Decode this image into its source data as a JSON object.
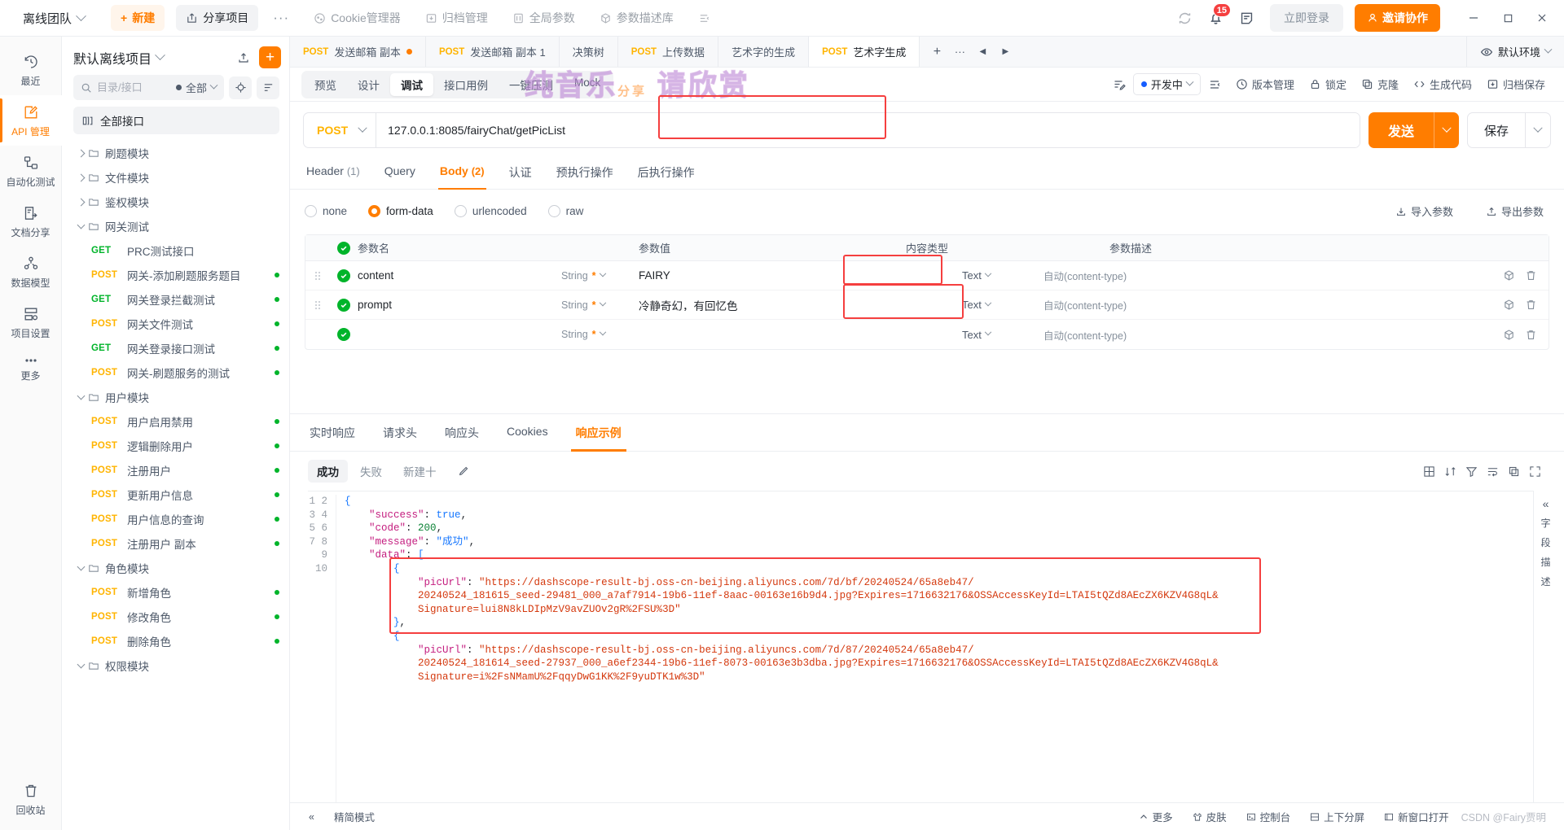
{
  "titlebar": {
    "team": "离线团队",
    "new_label": "新建",
    "share_label": "分享项目",
    "more_dots": "···",
    "menu": [
      {
        "label": "Cookie管理器",
        "icon": "cookie-icon"
      },
      {
        "label": "归档管理",
        "icon": "archive-icon"
      },
      {
        "label": "全局参数",
        "icon": "global-params-icon"
      },
      {
        "label": "参数描述库",
        "icon": "param-lib-icon"
      }
    ],
    "collapse_icon": "list-collapse-icon",
    "sync_icon": "sync-icon",
    "bell_icon": "bell-icon",
    "notif_count": "15",
    "note_icon": "note-icon",
    "login_label": "立即登录",
    "invite_label": "邀请协作",
    "minimize": "—",
    "maximize": "□",
    "close": "✕"
  },
  "rail": {
    "items": [
      {
        "label": "最近",
        "icon": "history-icon",
        "active": false
      },
      {
        "label": "API 管理",
        "icon": "api-edit-icon",
        "active": true
      },
      {
        "label": "自动化测试",
        "icon": "automation-icon",
        "active": false
      },
      {
        "label": "文档分享",
        "icon": "doc-share-icon",
        "active": false
      },
      {
        "label": "数据模型",
        "icon": "data-model-icon",
        "active": false
      },
      {
        "label": "项目设置",
        "icon": "project-settings-icon",
        "active": false
      },
      {
        "label": "更多",
        "icon": "more-dots-icon",
        "active": false
      }
    ],
    "bottom": {
      "label": "回收站",
      "icon": "trash-icon"
    }
  },
  "sidebar": {
    "project_name": "默认离线项目",
    "upload_icon": "upload-icon",
    "add_label": "+",
    "search_placeholder": "目录/接口",
    "filter_label": "全部",
    "target_icon": "target-icon",
    "sort_icon": "sort-icon",
    "all_apis": "全部接口",
    "all_apis_icon": "all-api-icon",
    "tree": [
      {
        "type": "folder",
        "label": "刷题模块",
        "expanded": false
      },
      {
        "type": "folder",
        "label": "文件模块",
        "expanded": false
      },
      {
        "type": "folder",
        "label": "鉴权模块",
        "expanded": false
      },
      {
        "type": "folder",
        "label": "网关测试",
        "expanded": true
      },
      {
        "type": "api",
        "method": "GET",
        "label": "PRC测试接口",
        "dot": false
      },
      {
        "type": "api",
        "method": "POST",
        "label": "网关-添加刷题服务题目",
        "dot": true
      },
      {
        "type": "api",
        "method": "GET",
        "label": "网关登录拦截测试",
        "dot": true
      },
      {
        "type": "api",
        "method": "POST",
        "label": "网关文件测试",
        "dot": true
      },
      {
        "type": "api",
        "method": "GET",
        "label": "网关登录接口测试",
        "dot": true
      },
      {
        "type": "api",
        "method": "POST",
        "label": "网关-刷题服务的测试",
        "dot": true
      },
      {
        "type": "folder",
        "label": "用户模块",
        "expanded": true
      },
      {
        "type": "api",
        "method": "POST",
        "label": "用户启用禁用",
        "dot": true
      },
      {
        "type": "api",
        "method": "POST",
        "label": "逻辑删除用户",
        "dot": true
      },
      {
        "type": "api",
        "method": "POST",
        "label": "注册用户",
        "dot": true
      },
      {
        "type": "api",
        "method": "POST",
        "label": "更新用户信息",
        "dot": true
      },
      {
        "type": "api",
        "method": "POST",
        "label": "用户信息的查询",
        "dot": true
      },
      {
        "type": "api",
        "method": "POST",
        "label": "注册用户 副本",
        "dot": true
      },
      {
        "type": "folder",
        "label": "角色模块",
        "expanded": true
      },
      {
        "type": "api",
        "method": "POST",
        "label": "新增角色",
        "dot": true
      },
      {
        "type": "api",
        "method": "POST",
        "label": "修改角色",
        "dot": true
      },
      {
        "type": "api",
        "method": "POST",
        "label": "删除角色",
        "dot": true
      },
      {
        "type": "folder",
        "label": "权限模块",
        "expanded": true
      }
    ],
    "footer": {
      "label": "回收站",
      "icon": "trash-icon"
    }
  },
  "doctabs": {
    "tabs": [
      {
        "method": "POST",
        "label": "发送邮箱 副本",
        "dot": true,
        "active": false
      },
      {
        "method": "POST",
        "label": "发送邮箱 副本 1",
        "dot": false,
        "active": false
      },
      {
        "method": "",
        "label": "决策树",
        "dot": false,
        "active": false
      },
      {
        "method": "POST",
        "label": "上传数据",
        "dot": false,
        "active": false
      },
      {
        "method": "",
        "label": "艺术字的生成",
        "dot": false,
        "active": false
      },
      {
        "method": "POST",
        "label": "艺术字生成",
        "dot": false,
        "active": true
      }
    ],
    "add": "+",
    "more": "···",
    "prev": "◀",
    "next": "▶",
    "env_label": "默认环境",
    "env_icon": "eye-icon"
  },
  "toolbar": {
    "segments": [
      {
        "label": "预览",
        "active": false
      },
      {
        "label": "设计",
        "active": false
      },
      {
        "label": "调试",
        "active": true
      },
      {
        "label": "接口用例",
        "active": false
      },
      {
        "label": "一键压测",
        "active": false
      },
      {
        "label": "Mock",
        "active": false
      }
    ],
    "watermark_main": "纯音乐",
    "watermark_sub": "分享",
    "watermark_tail": "请欣赏",
    "edit_icon": "edit-note-icon",
    "status_label": "开发中",
    "list_icon": "outline-icon",
    "actions": [
      {
        "label": "版本管理",
        "icon": "clock-icon"
      },
      {
        "label": "锁定",
        "icon": "lock-icon"
      },
      {
        "label": "克隆",
        "icon": "clone-icon"
      },
      {
        "label": "生成代码",
        "icon": "code-icon"
      },
      {
        "label": "归档保存",
        "icon": "archive-save-icon"
      }
    ]
  },
  "request": {
    "method": "POST",
    "url": "127.0.0.1:8085/fairyChat/getPicList",
    "send_label": "发送",
    "save_label": "保存",
    "tabs": [
      {
        "label": "Header",
        "count": "(1)",
        "active": false
      },
      {
        "label": "Query",
        "count": "",
        "active": false
      },
      {
        "label": "Body",
        "count": "(2)",
        "active": true
      },
      {
        "label": "认证",
        "count": "",
        "active": false
      },
      {
        "label": "预执行操作",
        "count": "",
        "active": false
      },
      {
        "label": "后执行操作",
        "count": "",
        "active": false
      }
    ],
    "body_types": [
      {
        "label": "none",
        "selected": false
      },
      {
        "label": "form-data",
        "selected": true
      },
      {
        "label": "urlencoded",
        "selected": false
      },
      {
        "label": "raw",
        "selected": false
      }
    ],
    "import_label": "导入参数",
    "export_label": "导出参数",
    "table_headers": [
      "参数名",
      "参数值",
      "内容类型",
      "参数描述"
    ],
    "rows": [
      {
        "name": "content",
        "type": "String",
        "required": "*",
        "value": "FAIRY",
        "ctype": "Text",
        "auto": "自动(content-type)",
        "desc": ""
      },
      {
        "name": "prompt",
        "type": "String",
        "required": "*",
        "value": "冷静奇幻，有回忆色",
        "ctype": "Text",
        "auto": "自动(content-type)",
        "desc": ""
      },
      {
        "name": "",
        "type": "String",
        "required": "*",
        "value": "",
        "ctype": "Text",
        "auto": "自动(content-type)",
        "desc": ""
      }
    ]
  },
  "response": {
    "tabs": [
      {
        "label": "实时响应",
        "active": false
      },
      {
        "label": "请求头",
        "active": false
      },
      {
        "label": "响应头",
        "active": false
      },
      {
        "label": "Cookies",
        "active": false
      },
      {
        "label": "响应示例",
        "active": true
      }
    ],
    "sub": [
      {
        "label": "成功",
        "active": true
      },
      {
        "label": "失败",
        "active": false
      }
    ],
    "new_label": "新建十",
    "edit_icon": "pencil-icon",
    "right_icons": [
      "grid-icon",
      "sort-icon",
      "filter-icon",
      "wrap-icon",
      "copy-icon",
      "expand-icon"
    ],
    "code_lines": [
      {
        "n": "1",
        "text": "{"
      },
      {
        "n": "2",
        "text": "    \"success\": true,"
      },
      {
        "n": "3",
        "text": "    \"code\": 200,"
      },
      {
        "n": "4",
        "text": "    \"message\": \"成功\","
      },
      {
        "n": "5",
        "text": "    \"data\": ["
      },
      {
        "n": "6",
        "text": "        {"
      },
      {
        "n": "7",
        "text": "            \"picUrl\": \"https://dashscope-result-bj.oss-cn-beijing.aliyuncs.com/7d/bf/20240524/65a8eb47/"
      },
      {
        "n": "",
        "text": "            20240524_181615_seed-29481_000_a7af7914-19b6-11ef-8aac-00163e16b9d4.jpg?Expires=1716632176&OSSAccessKeyId=LTAI5tQZd8AEcZX6KZV4G8qL&"
      },
      {
        "n": "",
        "text": "            Signature=lui8N8kLDIpMzV9avZUOv2gR%2FSU%3D\""
      },
      {
        "n": "8",
        "text": "        },"
      },
      {
        "n": "9",
        "text": "        {"
      },
      {
        "n": "10",
        "text": "            \"picUrl\": \"https://dashscope-result-bj.oss-cn-beijing.aliyuncs.com/7d/87/20240524/65a8eb47/"
      },
      {
        "n": "",
        "text": "            20240524_181614_seed-27937_000_a6ef2344-19b6-11ef-8073-00163e3b3dba.jpg?Expires=1716632176&OSSAccessKeyId=LTAI5tQZd8AEcZX6KZV4G8qL&"
      },
      {
        "n": "",
        "text": "            Signature=i%2FsNMamU%2FqqyDwG1KK%2F9yuDTK1w%3D\""
      }
    ],
    "side_labels": [
      "字",
      "段",
      "描",
      "述"
    ],
    "collapse_icon": "double-chevron-left-icon"
  },
  "statusbar": {
    "collapse": "«",
    "mode_label": "精简模式",
    "items": [
      {
        "label": "更多",
        "icon": "caret-up-icon"
      },
      {
        "label": "皮肤",
        "icon": "skin-icon"
      },
      {
        "label": "控制台",
        "icon": "console-icon"
      },
      {
        "label": "上下分屏",
        "icon": "split-icon"
      },
      {
        "label": "新窗口打开",
        "icon": "new-window-icon"
      }
    ],
    "watermark": "CSDN @Fairy贾明"
  }
}
